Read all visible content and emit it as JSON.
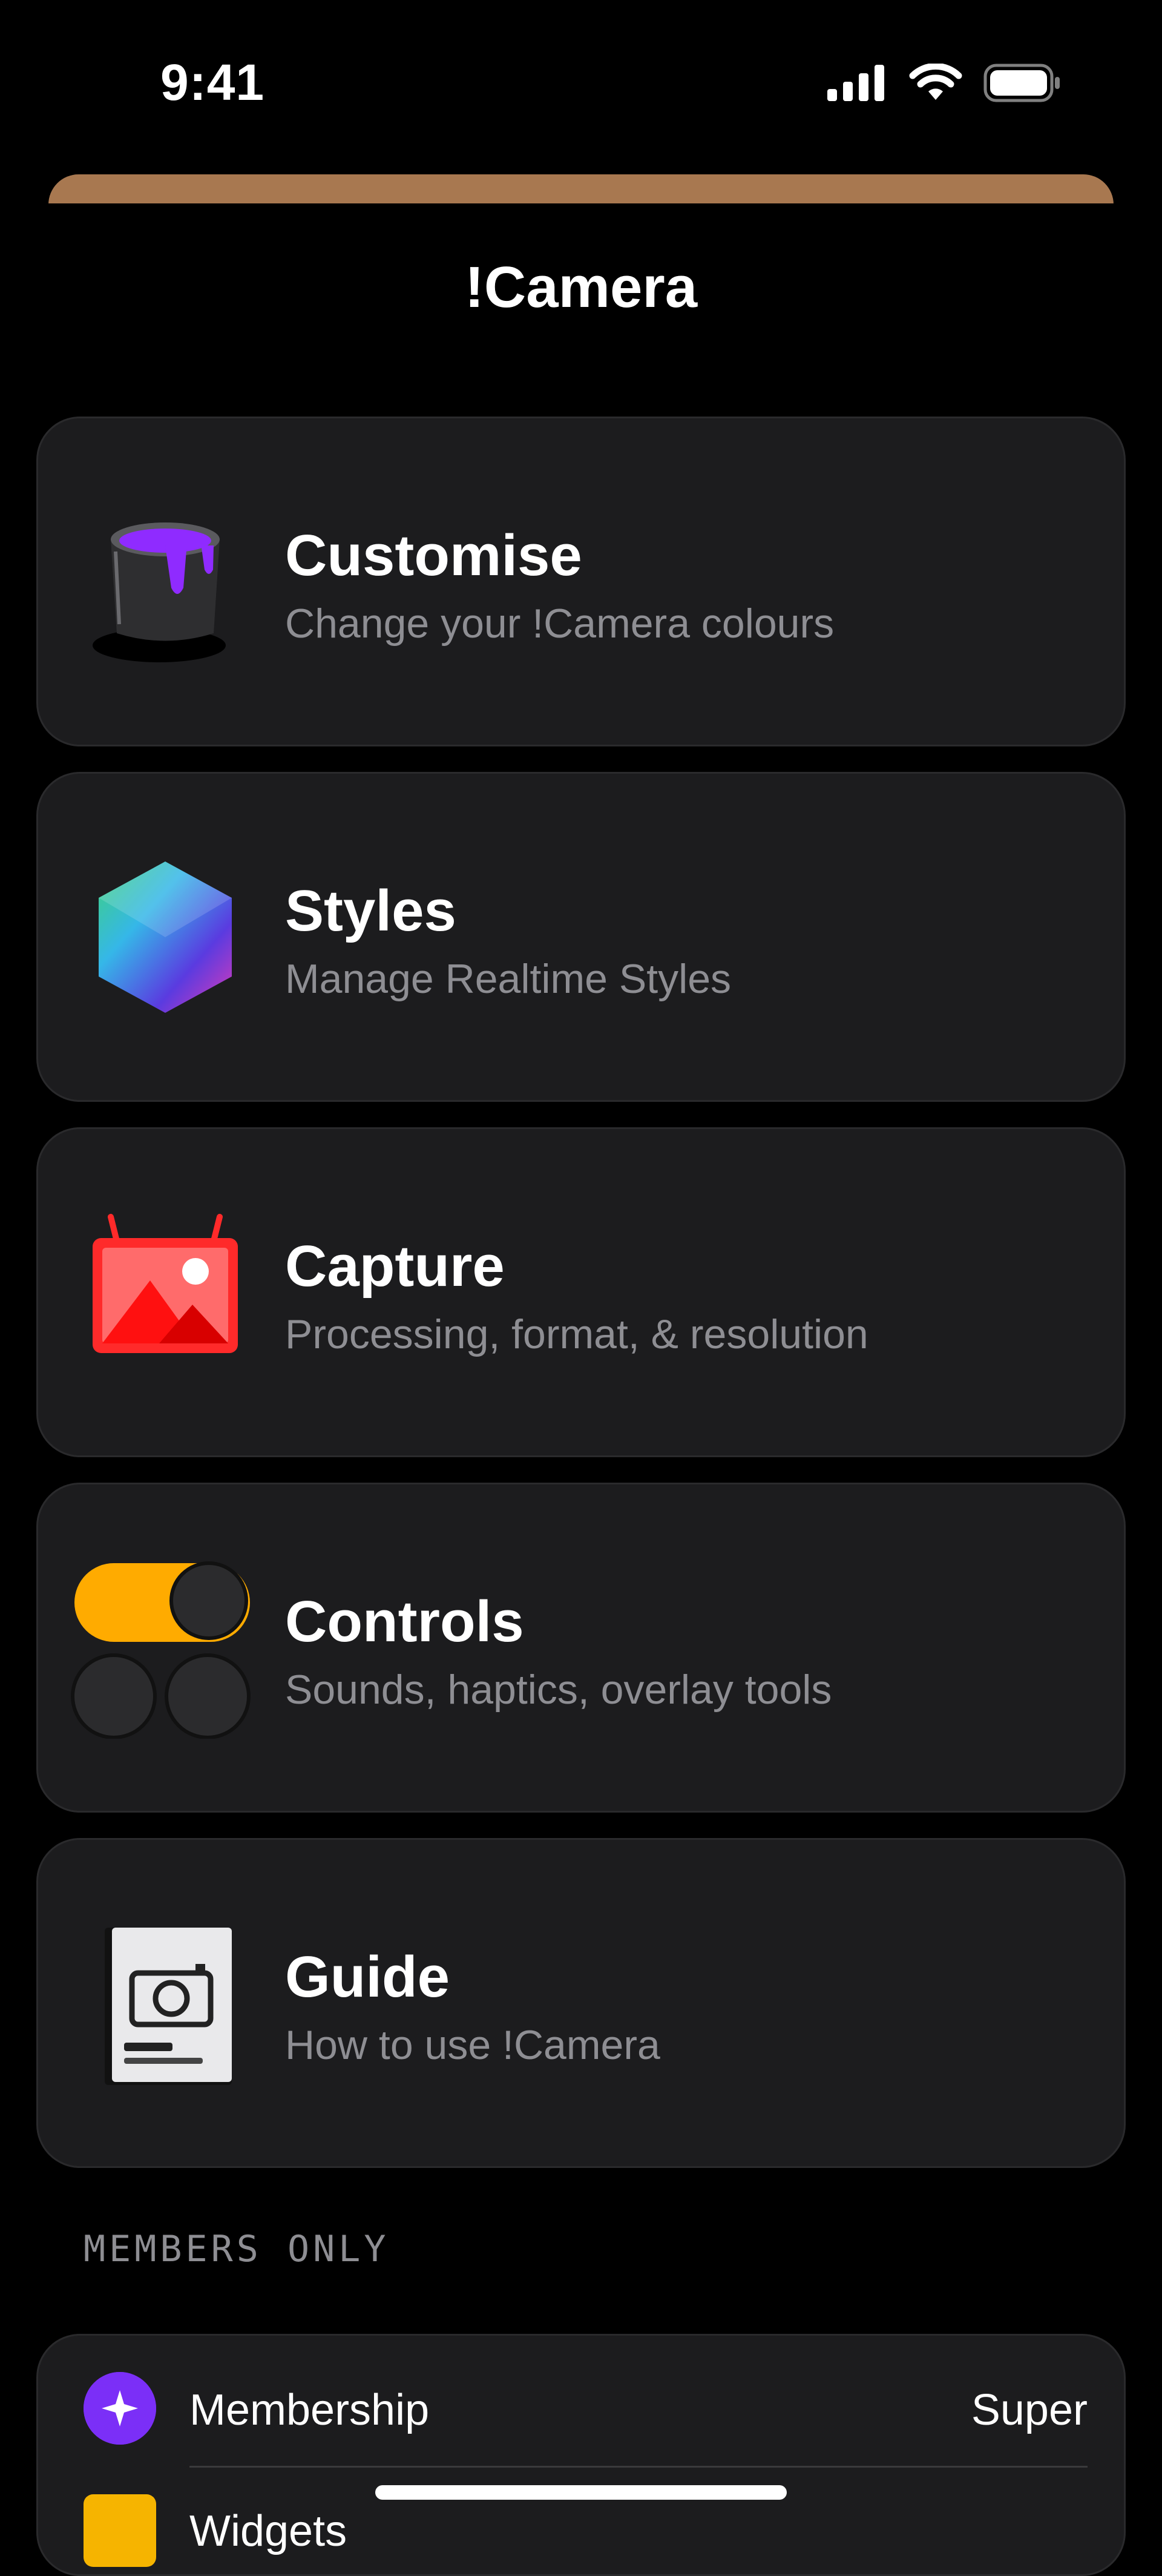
{
  "status_bar": {
    "time": "9:41",
    "icons": [
      "cellular-icon",
      "wifi-icon",
      "battery-icon"
    ]
  },
  "header": {
    "title": "!Camera"
  },
  "menu": [
    {
      "title": "Customise",
      "subtitle": "Change your !Camera colours",
      "icon": "paint-bucket-icon"
    },
    {
      "title": "Styles",
      "subtitle": "Manage Realtime Styles",
      "icon": "hexagon-gradient-icon"
    },
    {
      "title": "Capture",
      "subtitle": "Processing, format, & resolution",
      "icon": "photo-frame-icon"
    },
    {
      "title": "Controls",
      "subtitle": "Sounds, haptics, overlay tools",
      "icon": "toggles-icon"
    },
    {
      "title": "Guide",
      "subtitle": "How to use !Camera",
      "icon": "camera-guide-book-icon"
    }
  ],
  "members": {
    "header": "MEMBERS ONLY",
    "rows": [
      {
        "label": "Membership",
        "value": "Super",
        "icon": "sparkle-icon"
      },
      {
        "label": "Widgets",
        "value": "",
        "icon": "widget-icon"
      }
    ]
  },
  "colors": {
    "background": "#000000",
    "card": "#1c1c1e",
    "secondary_text": "#8e8e93",
    "sheet_peek": "#a87850",
    "accent": "#7b2ff7"
  }
}
